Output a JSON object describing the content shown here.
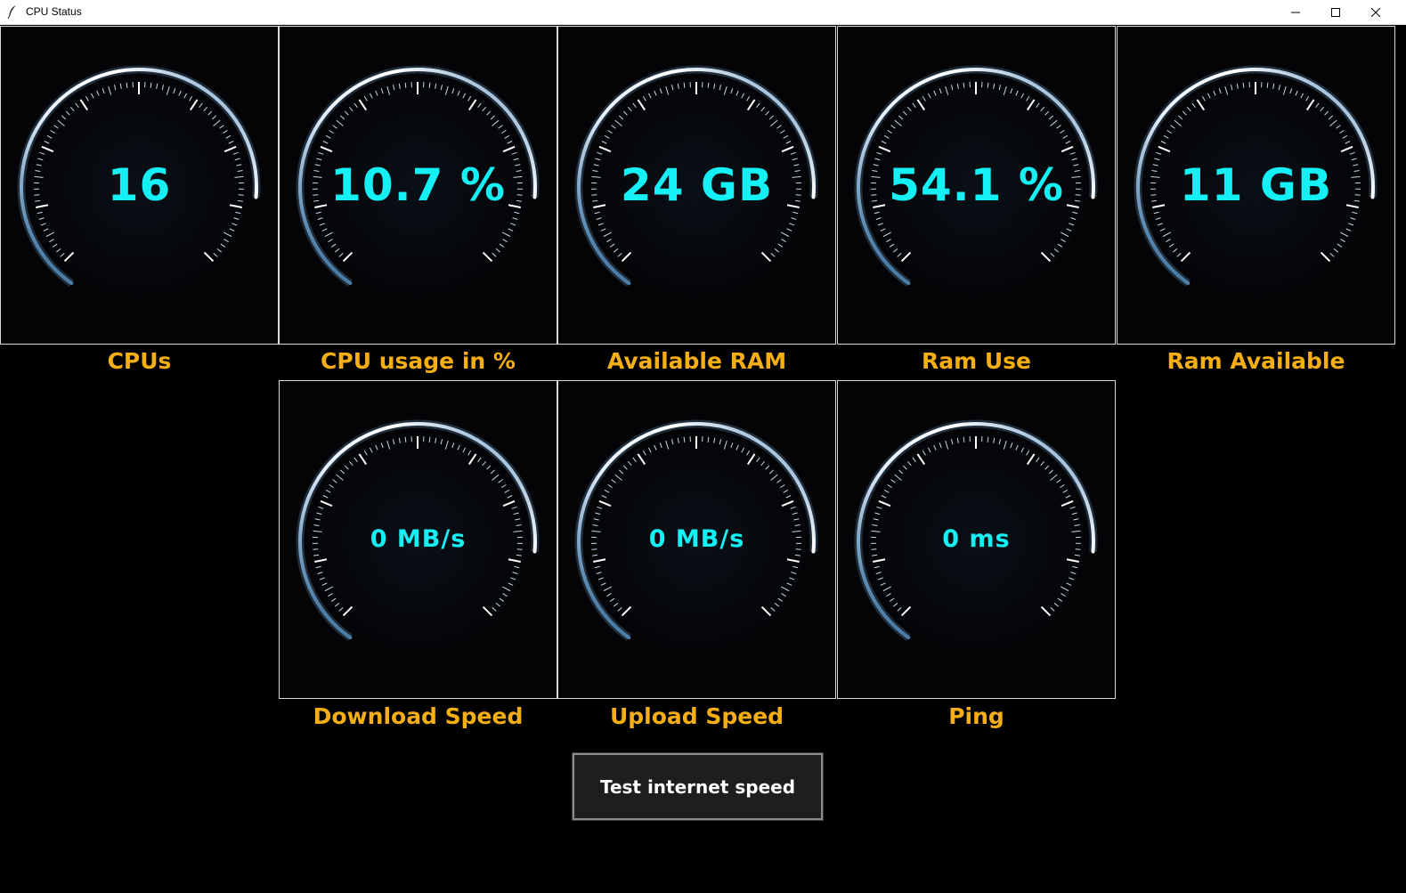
{
  "window": {
    "title": "CPU Status",
    "icon": "feather-icon",
    "controls": [
      "minimize-icon",
      "maximize-icon",
      "close-icon"
    ]
  },
  "colors": {
    "background": "#000000",
    "gauge_value": "#15f0f5",
    "gauge_label": "#f5ae14",
    "panel_border": "#d9d9d9",
    "button_background": "#1e1e1e",
    "button_text": "#ffffff"
  },
  "gauges_row1": [
    {
      "value": "16",
      "label": "CPUs"
    },
    {
      "value": "10.7 %",
      "label": "CPU usage in %"
    },
    {
      "value": "24 GB",
      "label": "Available RAM"
    },
    {
      "value": "54.1 %",
      "label": "Ram Use"
    },
    {
      "value": "11 GB",
      "label": "Ram Available"
    }
  ],
  "gauges_row2": [
    {
      "value": "0 MB/s",
      "label": "Download Speed"
    },
    {
      "value": "0 MB/s",
      "label": "Upload Speed"
    },
    {
      "value": "0 ms",
      "label": "Ping"
    }
  ],
  "actions": {
    "test_button_label": "Test internet speed"
  }
}
